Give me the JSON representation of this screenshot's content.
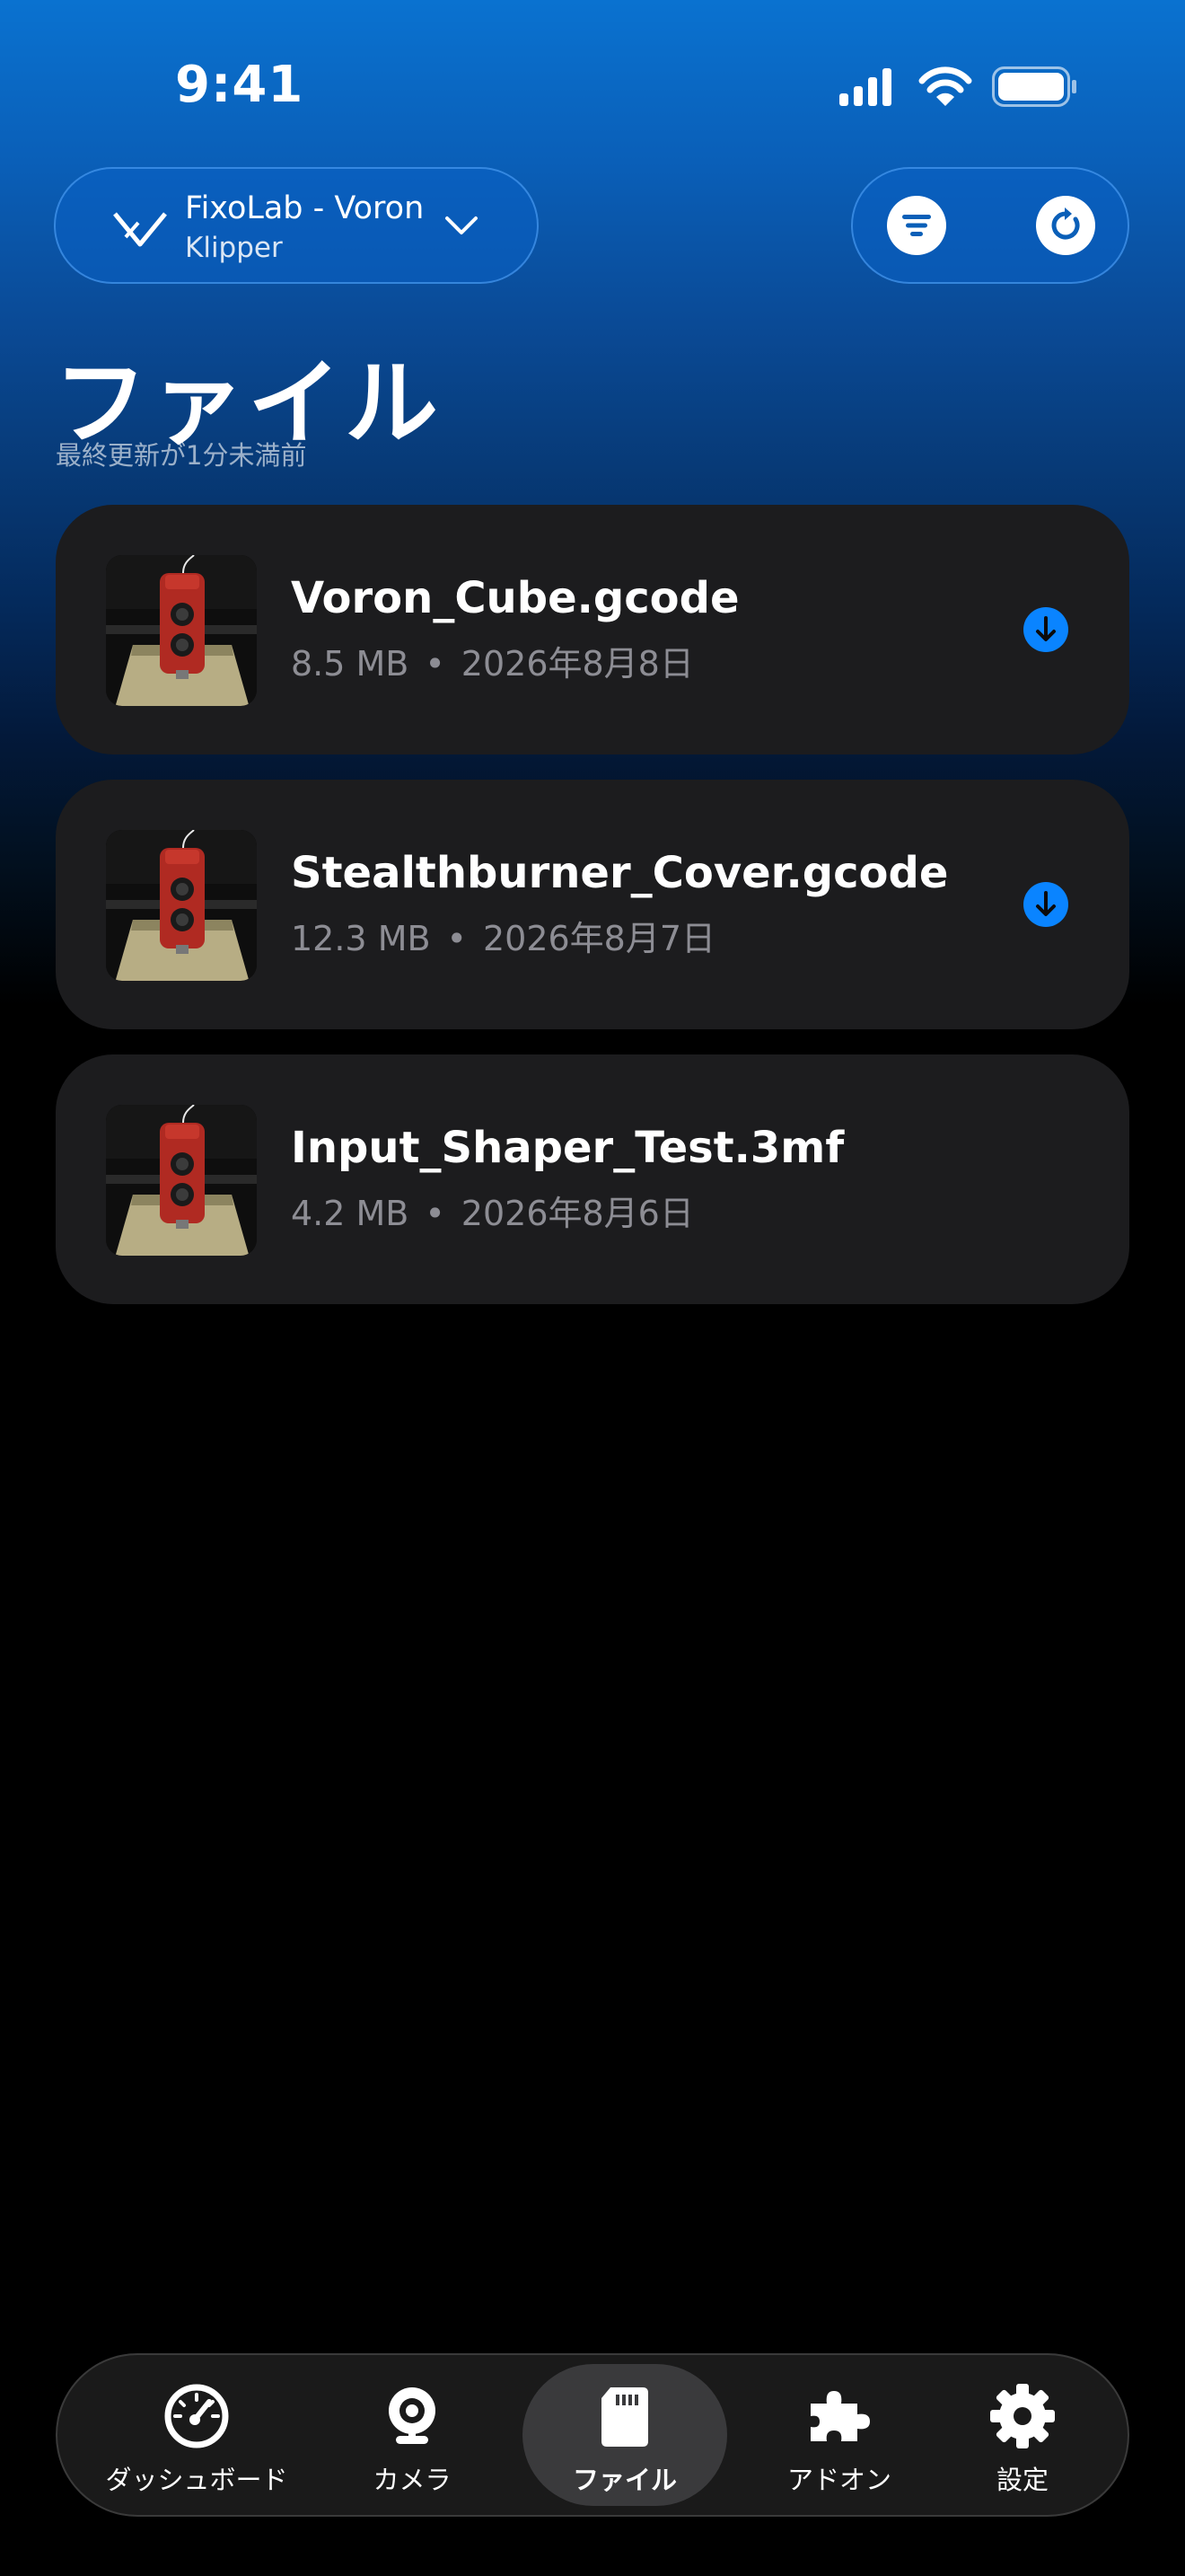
{
  "status_bar": {
    "time": "9:41"
  },
  "header": {
    "printer_name": "FixoLab - Voron",
    "printer_sub": "Klipper",
    "icons": [
      "voron-logo-icon",
      "chevron-down-icon",
      "filter-icon",
      "refresh-icon"
    ]
  },
  "page": {
    "title": "ファイル",
    "subtitle": "最終更新が1分未満前"
  },
  "files": [
    {
      "name": "Voron_Cube.gcode",
      "size": "8.5 MB",
      "date": "2026年8月8日",
      "downloadable": true
    },
    {
      "name": "Stealthburner_Cover.gcode",
      "size": "12.3 MB",
      "date": "2026年8月7日",
      "downloadable": true
    },
    {
      "name": "Input_Shaper_Test.3mf",
      "size": "4.2 MB",
      "date": "2026年8月6日",
      "downloadable": false
    }
  ],
  "meta_separator": "•",
  "tabs": [
    {
      "label": "ダッシュボード",
      "icon": "gauge-icon",
      "active": false
    },
    {
      "label": "カメラ",
      "icon": "webcam-icon",
      "active": false
    },
    {
      "label": "ファイル",
      "icon": "sd-card-icon",
      "active": true
    },
    {
      "label": "アドオン",
      "icon": "puzzle-icon",
      "active": false
    },
    {
      "label": "設定",
      "icon": "gear-icon",
      "active": false
    }
  ],
  "colors": {
    "accent": "#0a84ff",
    "card_bg": "#1c1c1e",
    "tab_bar_bg": "#1a1a1a",
    "tab_active_bg": "#3a3a3c"
  }
}
